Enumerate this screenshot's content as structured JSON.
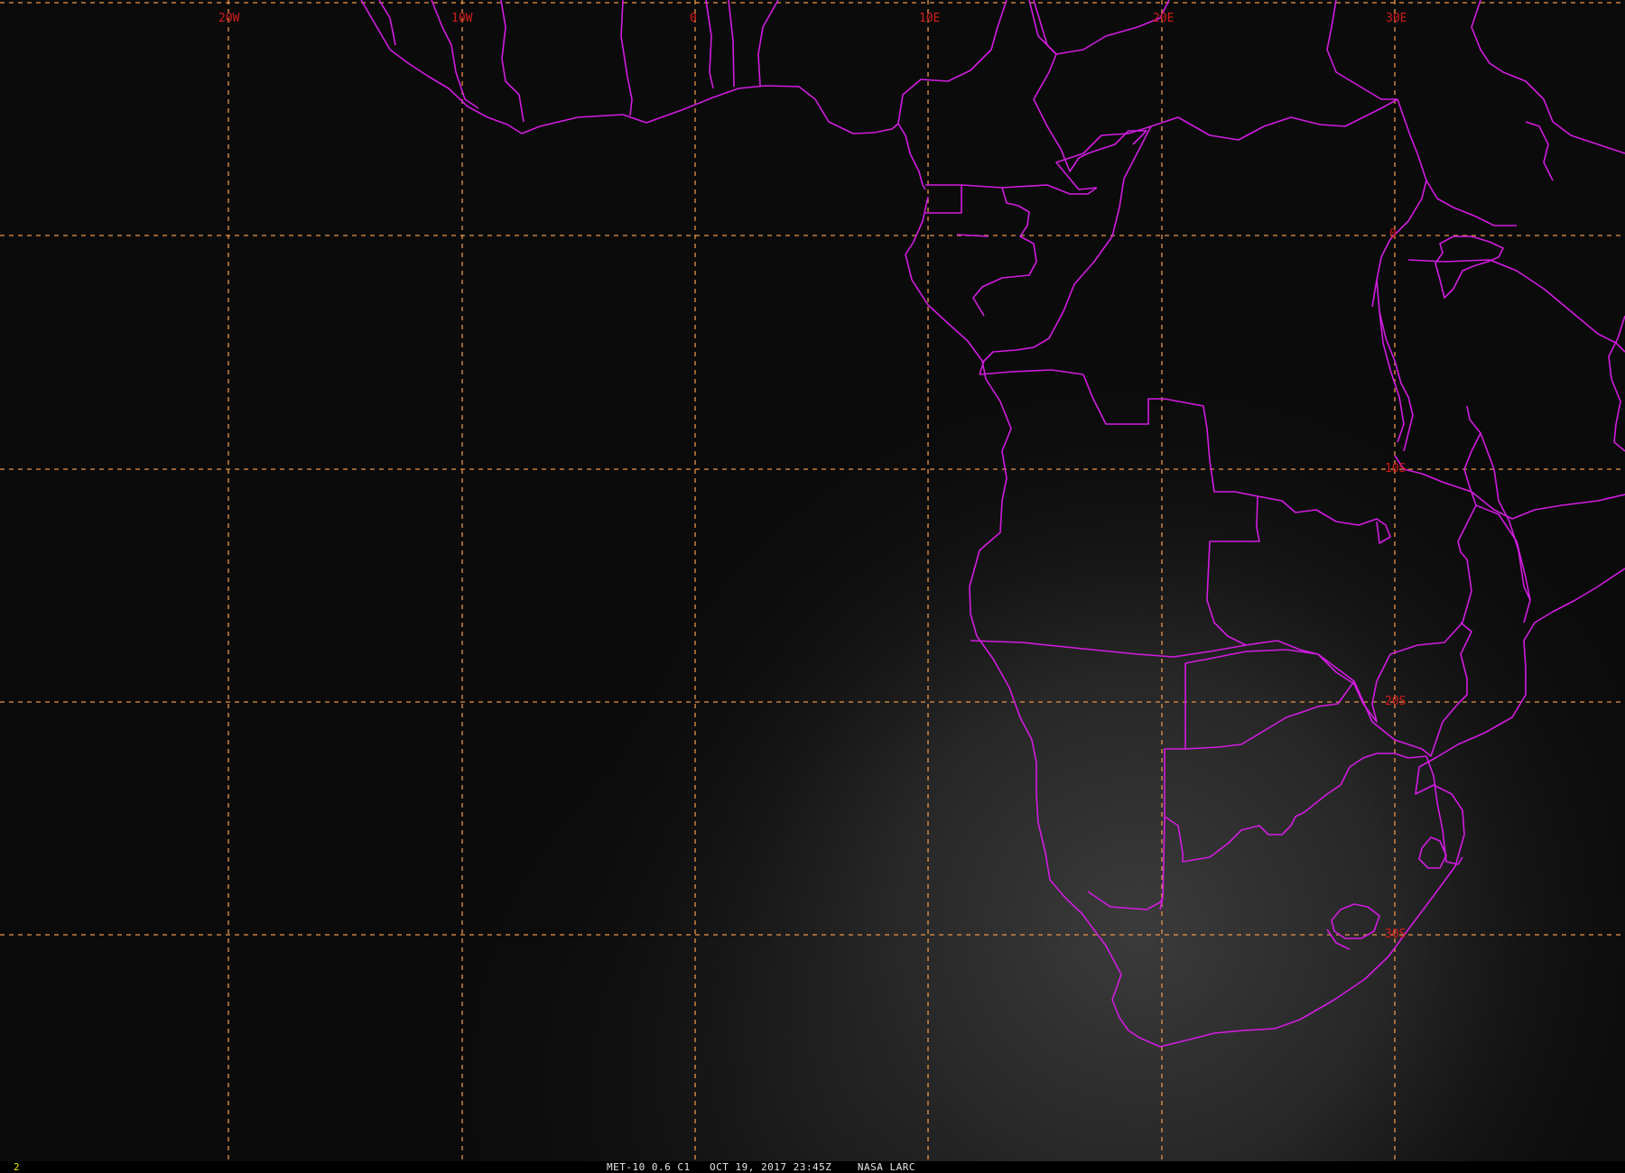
{
  "map": {
    "longitude_labels": [
      "20W",
      "10W",
      "0",
      "10E",
      "20E",
      "30E"
    ],
    "latitude_labels": [
      "0",
      "10S",
      "20S",
      "30S"
    ],
    "colors": {
      "background": "#0b0b0b",
      "graticule": "#e8954a",
      "graticule_labels": "#d21c1c",
      "borders": "#d21ce0"
    }
  },
  "status_bar": {
    "frame_number": "2",
    "satellite": "MET-10",
    "channel": "0.6 C1",
    "date": "OCT 19, 2017",
    "time": "23:45Z",
    "source": "NASA LARC"
  }
}
